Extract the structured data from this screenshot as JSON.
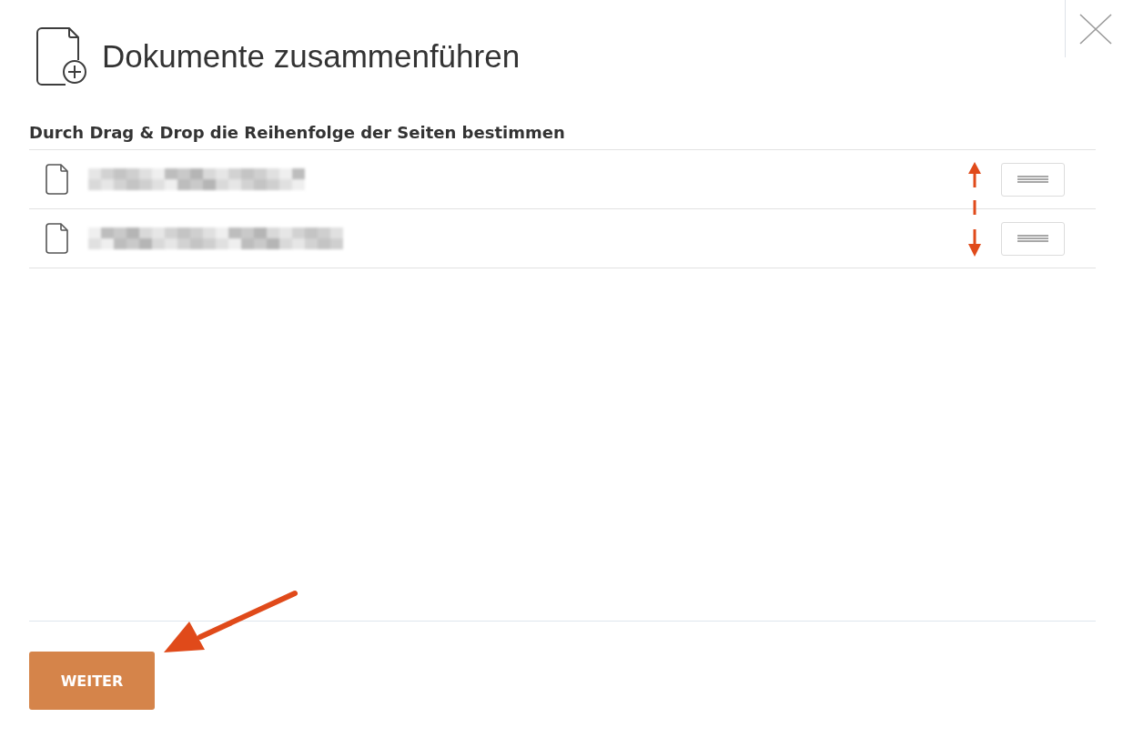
{
  "dialog": {
    "title": "Dokumente zusammenführen"
  },
  "instruction": "Durch Drag & Drop die Reihenfolge der Seiten bestimmen",
  "documents": [
    {
      "kind": "file",
      "redacted": true
    },
    {
      "kind": "file",
      "redacted": true
    }
  ],
  "buttons": [
    {
      "label": "WEITER",
      "kind": "primary"
    }
  ],
  "annotations": [
    {
      "kind": "reorder-arrow"
    },
    {
      "kind": "pointer-arrow"
    }
  ]
}
